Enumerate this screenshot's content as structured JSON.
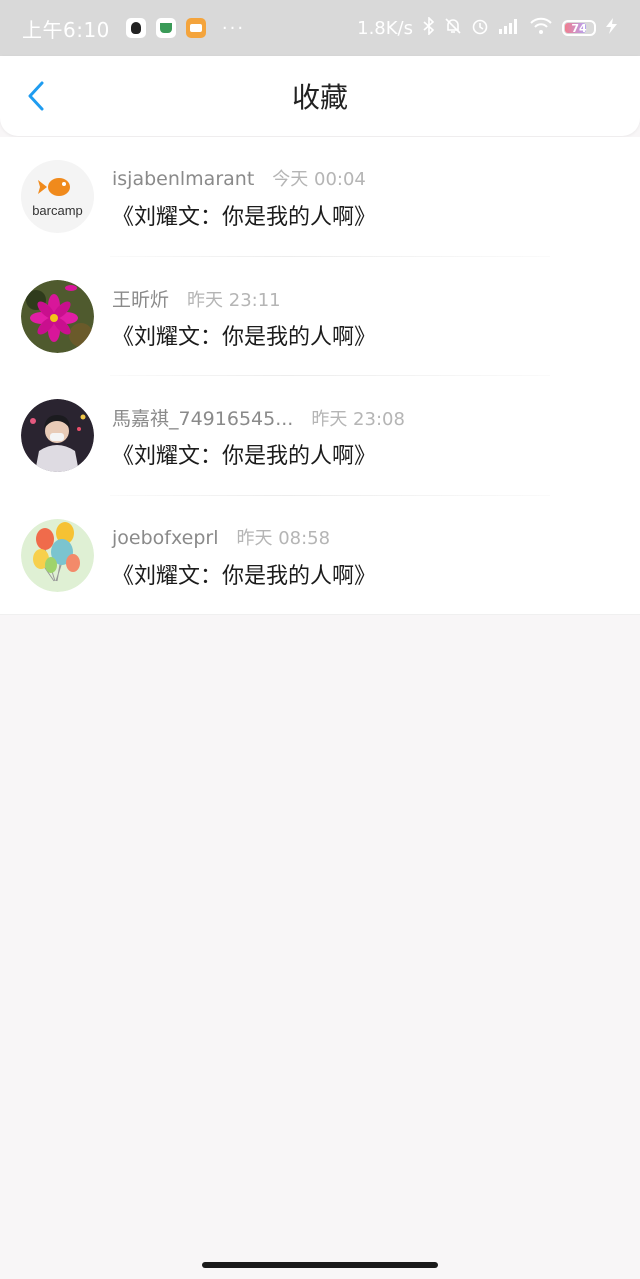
{
  "status_bar": {
    "time": "上午6:10",
    "more": "···",
    "net_speed": "1.8K/s",
    "battery": "74",
    "icons": [
      "qq-icon",
      "plant-app-icon",
      "box-app-icon",
      "bluetooth-icon",
      "mute-icon",
      "alarm-icon",
      "signal-icon",
      "wifi-icon",
      "battery-icon",
      "charging-icon"
    ]
  },
  "header": {
    "title": "收藏",
    "back_icon": "chevron-left-icon",
    "accent_color": "#1f9cf0"
  },
  "favorites": [
    {
      "username": "isjabenlmarant",
      "time": "今天 00:04",
      "content": "《刘耀文：你是我的人啊》",
      "avatar": "barcamp-logo-avatar",
      "avatar_label": "barcamp"
    },
    {
      "username": "王昕炘",
      "time": "昨天 23:11",
      "content": "《刘耀文：你是我的人啊》",
      "avatar": "pink-flower-avatar"
    },
    {
      "username": "馬嘉祺_74916545...",
      "time": "昨天 23:08",
      "content": "《刘耀文：你是我的人啊》",
      "avatar": "person-photo-avatar"
    },
    {
      "username": "joebofxeprl",
      "time": "昨天 08:58",
      "content": "《刘耀文：你是我的人啊》",
      "avatar": "balloons-avatar"
    }
  ]
}
